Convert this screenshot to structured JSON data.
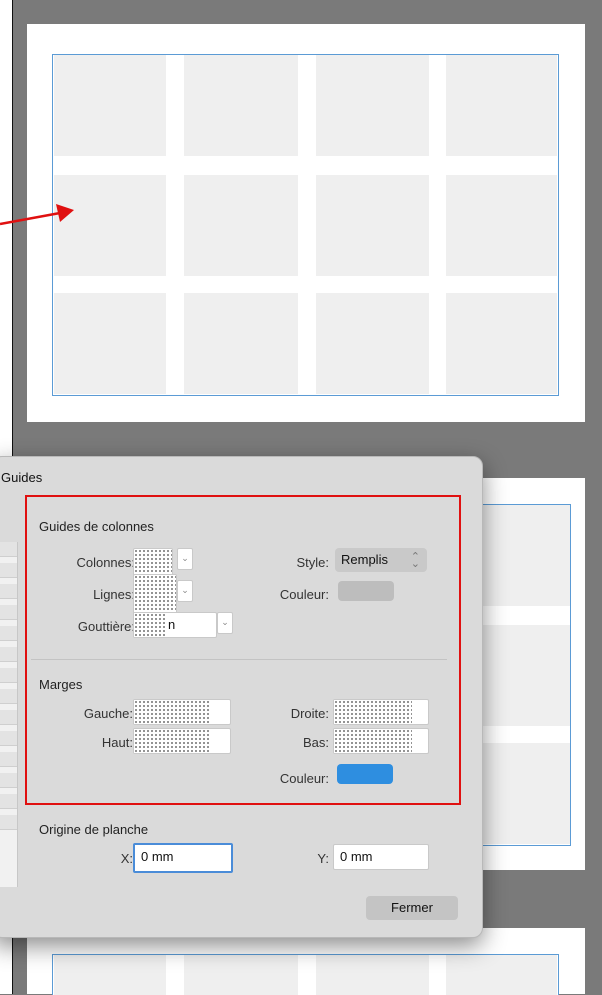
{
  "dialog": {
    "title": "Guides",
    "column_guides": {
      "heading": "Guides de colonnes",
      "columns_label": "Colonnes:",
      "rows_label": "Lignes:",
      "gutter_label": "Gouttière:",
      "gutter_value": "n",
      "style_label": "Style:",
      "style_value": "Remplis",
      "color_label": "Couleur:",
      "color_value": "#bdbdbd"
    },
    "margins": {
      "heading": "Marges",
      "left_label": "Gauche:",
      "right_label": "Droite:",
      "top_label": "Haut:",
      "bottom_label": "Bas:",
      "color_label": "Couleur:",
      "color_value": "#2e8ee0"
    },
    "origin": {
      "heading": "Origine de planche",
      "x_label": "X:",
      "x_value": "0 mm",
      "y_label": "Y:",
      "y_value": "0 mm"
    },
    "close_button": "Fermer"
  },
  "annotations": {
    "arrow_color": "#e01010",
    "highlight_color": "#e01010"
  }
}
